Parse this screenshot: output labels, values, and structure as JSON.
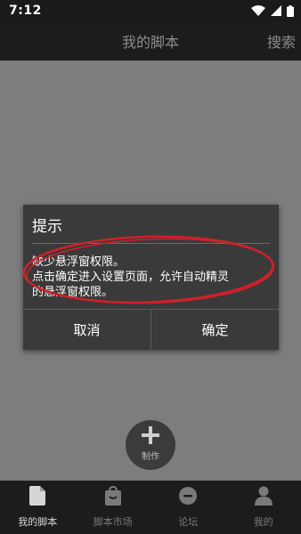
{
  "status_bar": {
    "time": "7:12",
    "icons": [
      "wifi-icon",
      "signal-icon",
      "battery-icon"
    ]
  },
  "header": {
    "title": "我的脚本",
    "search_label": "搜索"
  },
  "dialog": {
    "title": "提示",
    "message_lines": [
      "缺少悬浮窗权限。",
      "点击确定进入设置页面，允许自动精灵",
      "的悬浮窗权限。"
    ],
    "cancel_label": "取消",
    "confirm_label": "确定"
  },
  "fab": {
    "label": "制作",
    "icon": "plus-icon"
  },
  "bottom_nav": {
    "items": [
      {
        "label": "我的脚本",
        "icon": "document-icon",
        "active": true
      },
      {
        "label": "脚本市场",
        "icon": "shopping-bag-icon",
        "active": false
      },
      {
        "label": "论坛",
        "icon": "chat-icon",
        "active": false
      },
      {
        "label": "我的",
        "icon": "person-icon",
        "active": false
      }
    ]
  },
  "colors": {
    "overlay": "#7d7d7d",
    "bar": "#1c1c1c",
    "dialog": "#3a3a3a",
    "annotation": "#d0202a",
    "active_nav": "#d6d6d6",
    "inactive_nav": "#7a7a7a"
  }
}
